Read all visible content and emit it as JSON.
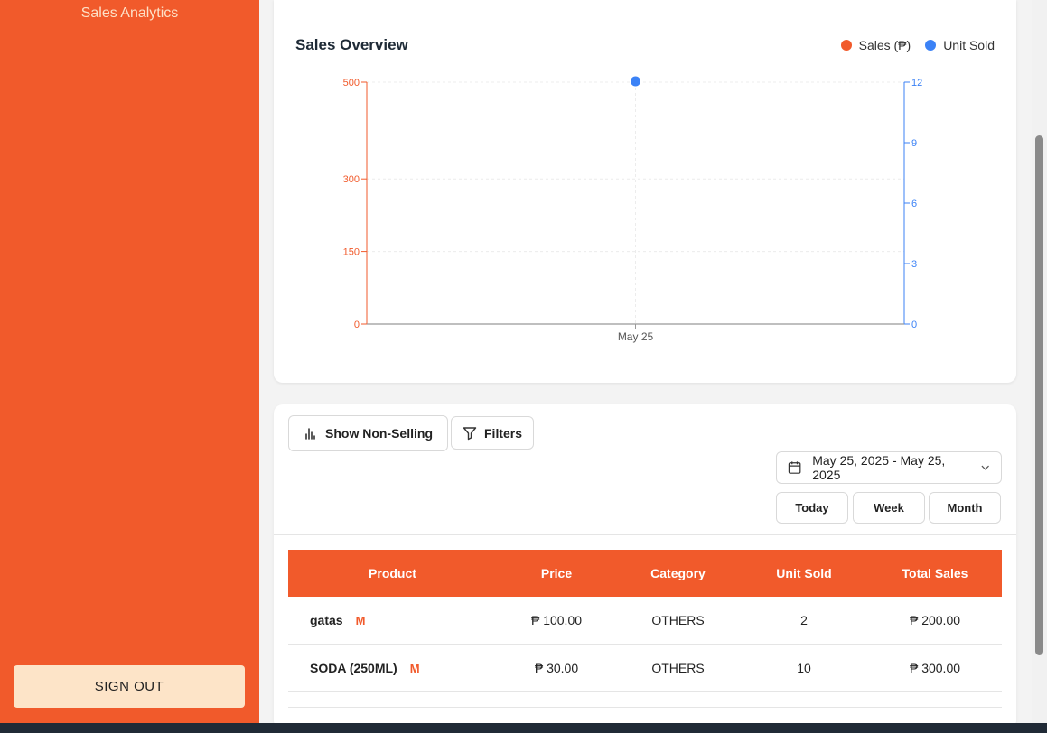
{
  "sidebar": {
    "active_item": "Sales Analytics",
    "signout_label": "SIGN OUT"
  },
  "chart": {
    "title": "Sales Overview",
    "legend": [
      {
        "label": "Sales (₱)",
        "color": "#f15a2b"
      },
      {
        "label": "Unit Sold",
        "color": "#3b82f6"
      }
    ]
  },
  "chart_data": {
    "type": "line",
    "x": [
      "May 25"
    ],
    "series": [
      {
        "name": "Sales (₱)",
        "axis": "left",
        "color": "#f15a2b",
        "values": [
          500
        ]
      },
      {
        "name": "Unit Sold",
        "axis": "right",
        "color": "#3b82f6",
        "values": [
          12
        ]
      }
    ],
    "left_ticks": [
      0,
      150,
      300,
      500
    ],
    "right_ticks": [
      0,
      3,
      6,
      9,
      12
    ],
    "ylim_left": [
      0,
      500
    ],
    "ylim_right": [
      0,
      12
    ],
    "grid": true,
    "legend_position": "top-right"
  },
  "controls": {
    "show_non_selling_label": "Show Non-Selling",
    "filters_label": "Filters",
    "date_range": "May 25, 2025 - May 25, 2025",
    "range_buttons": [
      "Today",
      "Week",
      "Month"
    ]
  },
  "table": {
    "headers": [
      "Product",
      "Price",
      "Category",
      "Unit Sold",
      "Total Sales"
    ],
    "rows": [
      {
        "product": "gatas",
        "badge": "M",
        "price": "₱ 100.00",
        "category": "OTHERS",
        "units": "2",
        "total": "₱ 200.00"
      },
      {
        "product": "SODA (250ML)",
        "badge": "M",
        "price": "₱ 30.00",
        "category": "OTHERS",
        "units": "10",
        "total": "₱ 300.00"
      }
    ]
  }
}
